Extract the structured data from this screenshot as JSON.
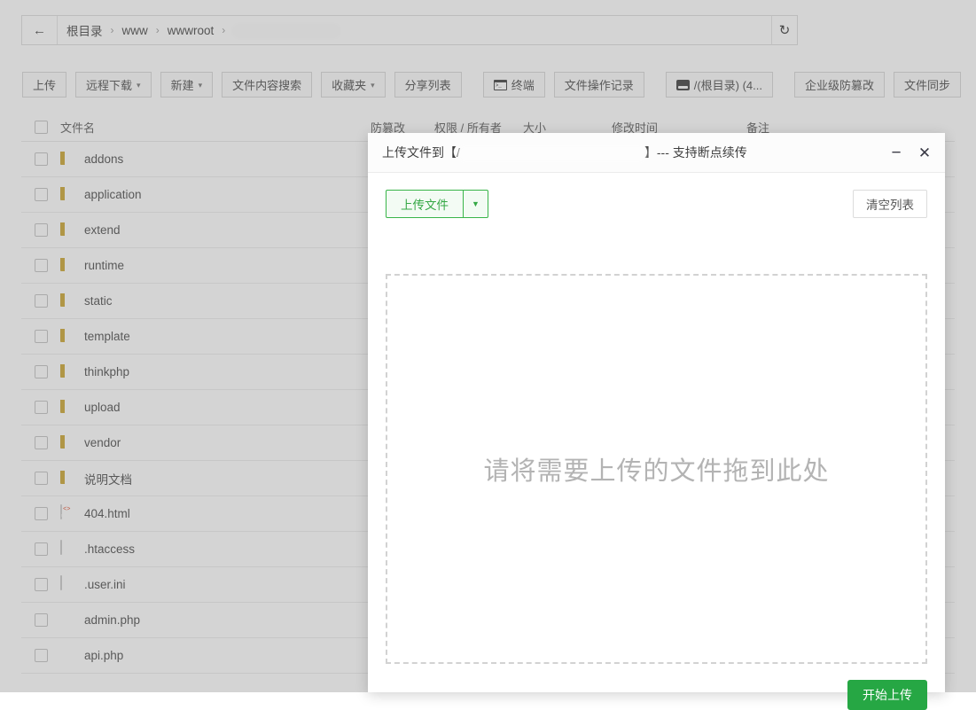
{
  "breadcrumb": {
    "back_icon": "arrow-left-icon",
    "items": [
      "根目录",
      "www",
      "wwwroot"
    ],
    "separator": "›",
    "redacted_segment": "",
    "refresh_icon": "refresh-icon"
  },
  "toolbar": {
    "buttons": [
      {
        "label": "上传",
        "caret": false,
        "icon": ""
      },
      {
        "label": "远程下载",
        "caret": true,
        "icon": ""
      },
      {
        "label": "新建",
        "caret": true,
        "icon": ""
      },
      {
        "label": "文件内容搜索",
        "caret": false,
        "icon": ""
      },
      {
        "label": "收藏夹",
        "caret": true,
        "icon": ""
      },
      {
        "label": "分享列表",
        "caret": false,
        "icon": ""
      },
      {
        "label": "终端",
        "caret": false,
        "icon": "terminal-icon"
      },
      {
        "label": "文件操作记录",
        "caret": false,
        "icon": ""
      },
      {
        "label": "/(根目录) (4...",
        "caret": false,
        "icon": "disk-icon"
      },
      {
        "label": "企业级防篡改",
        "caret": false,
        "icon": ""
      },
      {
        "label": "文件同步",
        "caret": false,
        "icon": ""
      }
    ]
  },
  "table": {
    "headers": {
      "name": "文件名",
      "protect": "防篡改",
      "perm": "权限 / 所有者",
      "size": "大小",
      "mtime": "修改时间",
      "note": "备注"
    },
    "rows": [
      {
        "name": "addons",
        "icon": "folder-icon",
        "protect": "",
        "perm": "",
        "size": "",
        "mtime": "",
        "note": ""
      },
      {
        "name": "application",
        "icon": "folder-icon",
        "protect": "",
        "perm": "",
        "size": "",
        "mtime": "",
        "note": ""
      },
      {
        "name": "extend",
        "icon": "folder-icon",
        "protect": "",
        "perm": "",
        "size": "",
        "mtime": "",
        "note": ""
      },
      {
        "name": "runtime",
        "icon": "folder-icon",
        "protect": "",
        "perm": "",
        "size": "",
        "mtime": "",
        "note": ""
      },
      {
        "name": "static",
        "icon": "folder-icon",
        "protect": "",
        "perm": "",
        "size": "",
        "mtime": "",
        "note": ""
      },
      {
        "name": "template",
        "icon": "folder-icon",
        "protect": "",
        "perm": "",
        "size": "",
        "mtime": "",
        "note": ""
      },
      {
        "name": "thinkphp",
        "icon": "folder-icon",
        "protect": "",
        "perm": "",
        "size": "",
        "mtime": "",
        "note": ""
      },
      {
        "name": "upload",
        "icon": "folder-icon",
        "protect": "",
        "perm": "",
        "size": "",
        "mtime": "",
        "note": ""
      },
      {
        "name": "vendor",
        "icon": "folder-icon",
        "protect": "",
        "perm": "",
        "size": "",
        "mtime": "",
        "note": ""
      },
      {
        "name": "说明文档",
        "icon": "folder-icon",
        "protect": "",
        "perm": "",
        "size": "",
        "mtime": "",
        "note": ""
      },
      {
        "name": "404.html",
        "icon": "html-file-icon",
        "protect": "",
        "perm": "",
        "size": "",
        "mtime": "",
        "note": ""
      },
      {
        "name": ".htaccess",
        "icon": "text-file-icon",
        "protect": "",
        "perm": "",
        "size": "",
        "mtime": "",
        "note": ""
      },
      {
        "name": ".user.ini",
        "icon": "text-file-icon",
        "protect": "",
        "perm": "",
        "size": "",
        "mtime": "",
        "note": ""
      },
      {
        "name": "admin.php",
        "icon": "php-file-icon",
        "protect": "",
        "perm": "",
        "size": "",
        "mtime": "",
        "note": ""
      },
      {
        "name": "api.php",
        "icon": "php-file-icon",
        "protect": "",
        "perm": "",
        "size": "",
        "mtime": "",
        "note": ""
      }
    ]
  },
  "modal": {
    "title_prefix": "上传文件到【/",
    "title_suffix": "】--- 支持断点续传",
    "minimize_icon": "minimize-icon",
    "close_icon": "close-icon",
    "upload_button": "上传文件",
    "upload_caret_icon": "chevron-down-icon",
    "clear_button": "清空列表",
    "dropzone_text": "请将需要上传的文件拖到此处",
    "start_button": "开始上传"
  },
  "colors": {
    "accent_green": "#26a744",
    "outline_green": "#39b549",
    "folder_yellow": "#e2b93b",
    "php_blue": "#4f5b93"
  }
}
